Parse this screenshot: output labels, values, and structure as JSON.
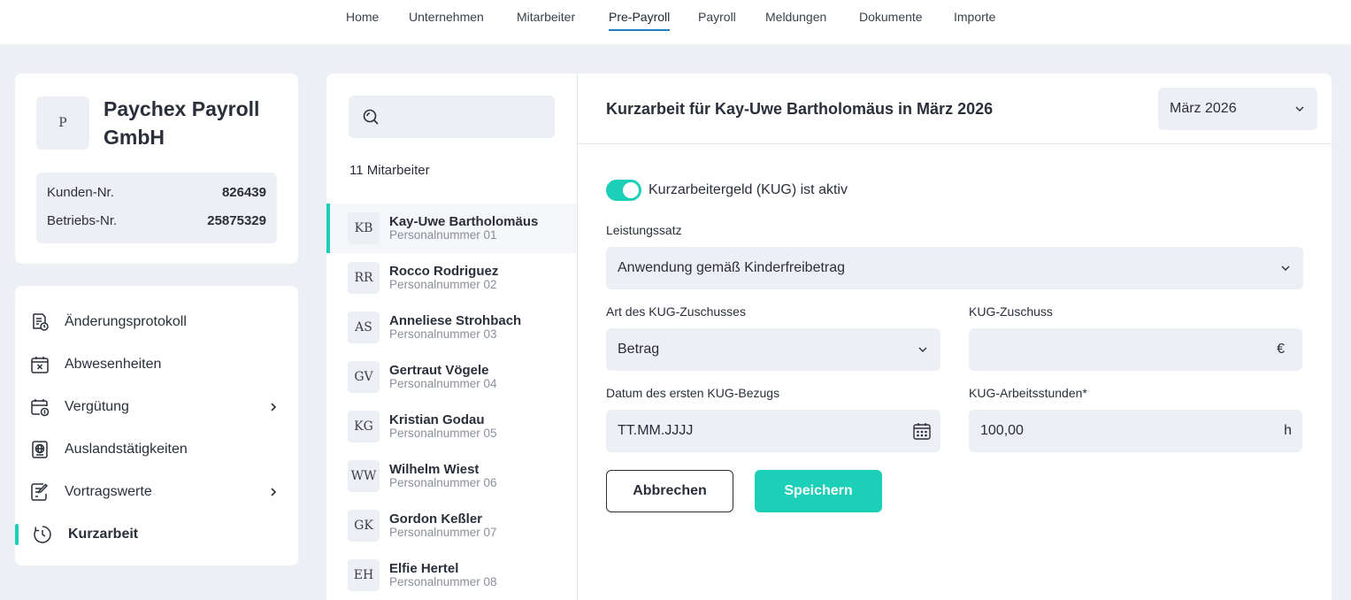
{
  "topnav": {
    "items": [
      {
        "label": "Home",
        "active": false
      },
      {
        "label": "Unternehmen",
        "active": false
      },
      {
        "label": "Mitarbeiter",
        "active": false
      },
      {
        "label": "Pre-Payroll",
        "active": true
      },
      {
        "label": "Payroll",
        "active": false
      },
      {
        "label": "Meldungen",
        "active": false
      },
      {
        "label": "Dokumente",
        "active": false
      },
      {
        "label": "Importe",
        "active": false
      }
    ]
  },
  "company": {
    "logo_initial": "P",
    "name": "Paychex Payroll GmbH",
    "kunden_label": "Kunden-Nr.",
    "kunden_value": "826439",
    "betriebs_label": "Betriebs-Nr.",
    "betriebs_value": "25875329"
  },
  "menu": {
    "items": [
      {
        "label": "Änderungsprotokoll",
        "icon": "change-log-icon",
        "chevron": false,
        "active": false
      },
      {
        "label": "Abwesenheiten",
        "icon": "calendar-x-icon",
        "chevron": false,
        "active": false
      },
      {
        "label": "Vergütung",
        "icon": "calendar-money-icon",
        "chevron": true,
        "active": false
      },
      {
        "label": "Auslandstätigkeiten",
        "icon": "passport-icon",
        "chevron": false,
        "active": false
      },
      {
        "label": "Vortragswerte",
        "icon": "edit-document-icon",
        "chevron": true,
        "active": false
      },
      {
        "label": "Kurzarbeit",
        "icon": "clock-icon",
        "chevron": false,
        "active": true
      }
    ]
  },
  "employee_list": {
    "search_placeholder": "",
    "count_label": "11 Mitarbeiter",
    "employees": [
      {
        "initials": "KB",
        "name": "Kay-Uwe Bartholomäus",
        "number": "Personalnummer 01",
        "active": true
      },
      {
        "initials": "RR",
        "name": "Rocco Rodriguez",
        "number": "Personalnummer 02",
        "active": false
      },
      {
        "initials": "AS",
        "name": "Anneliese Strohbach",
        "number": "Personalnummer 03",
        "active": false
      },
      {
        "initials": "GV",
        "name": "Gertraut Vögele",
        "number": "Personalnummer 04",
        "active": false
      },
      {
        "initials": "KG",
        "name": "Kristian Godau",
        "number": "Personalnummer 05",
        "active": false
      },
      {
        "initials": "WW",
        "name": "Wilhelm Wiest",
        "number": "Personalnummer 06",
        "active": false
      },
      {
        "initials": "GK",
        "name": "Gordon Keßler",
        "number": "Personalnummer 07",
        "active": false
      },
      {
        "initials": "EH",
        "name": "Elfie Hertel",
        "number": "Personalnummer 08",
        "active": false
      }
    ]
  },
  "detail": {
    "title": "Kurzarbeit für Kay-Uwe Bartholomäus in März 2026",
    "month_value": "März 2026",
    "toggle_on": true,
    "toggle_label": "Kurzarbeitergeld (KUG) ist aktiv",
    "leistungssatz_label": "Leistungssatz",
    "leistungssatz_value": "Anwendung gemäß Kinderfreibetrag",
    "zuschuss_art_label": "Art des KUG-Zuschusses",
    "zuschuss_art_value": "Betrag",
    "zuschuss_label": "KUG-Zuschuss",
    "zuschuss_value": "",
    "zuschuss_unit": "€",
    "datum_label": "Datum des ersten KUG-Bezugs",
    "datum_placeholder": "TT.MM.JJJJ",
    "stunden_label": "KUG-Arbeitsstunden*",
    "stunden_value": "100,00",
    "stunden_unit": "h",
    "cancel_label": "Abbrechen",
    "save_label": "Speichern"
  },
  "colors": {
    "accent": "#1ccfb8",
    "nav_underline": "#1e7fc2",
    "background": "#eceff4"
  }
}
